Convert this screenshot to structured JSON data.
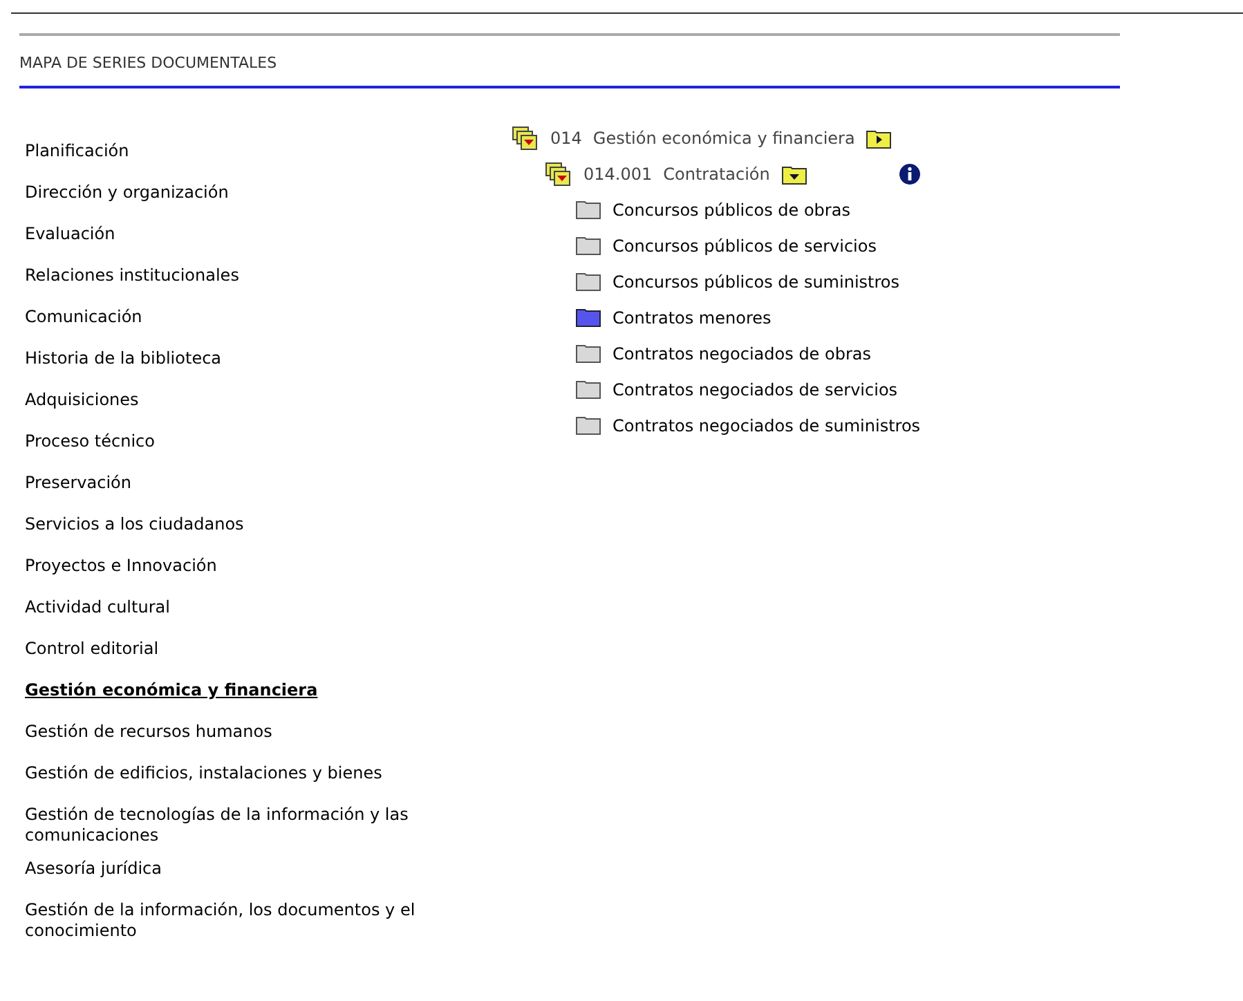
{
  "header": {
    "title": "MAPA DE SERIES DOCUMENTALES"
  },
  "functions": [
    {
      "label": "Planificación",
      "selected": false
    },
    {
      "label": "Dirección y organización",
      "selected": false
    },
    {
      "label": "Evaluación",
      "selected": false
    },
    {
      "label": "Relaciones institucionales",
      "selected": false
    },
    {
      "label": "Comunicación",
      "selected": false
    },
    {
      "label": "Historia de la biblioteca",
      "selected": false
    },
    {
      "label": "Adquisiciones",
      "selected": false
    },
    {
      "label": "Proceso técnico",
      "selected": false
    },
    {
      "label": "Preservación",
      "selected": false
    },
    {
      "label": "Servicios a los ciudadanos",
      "selected": false
    },
    {
      "label": "Proyectos e Innovación",
      "selected": false
    },
    {
      "label": "Actividad cultural",
      "selected": false
    },
    {
      "label": "Control editorial",
      "selected": false
    },
    {
      "label": "Gestión económica y financiera",
      "selected": true
    },
    {
      "label": "Gestión de recursos humanos",
      "selected": false
    },
    {
      "label": "Gestión de edificios, instalaciones y bienes",
      "selected": false
    },
    {
      "label": "Gestión de tecnologías de la información y las comunicaciones",
      "selected": false
    },
    {
      "label": "Asesoría jurídica",
      "selected": false
    },
    {
      "label": "Gestión de la información, los documentos y el conocimiento",
      "selected": false
    }
  ],
  "tree": {
    "code": "014",
    "name": "Gestión económica y financiera",
    "expanded": true,
    "children": [
      {
        "code": "014.001",
        "name": "Contratación",
        "expanded": true,
        "children": [
          {
            "label": "Concursos públicos de obras",
            "selected": false
          },
          {
            "label": "Concursos públicos de servicios",
            "selected": false
          },
          {
            "label": "Concursos públicos de suministros",
            "selected": false
          },
          {
            "label": "Contratos menores",
            "selected": true
          },
          {
            "label": "Contratos negociados de obras",
            "selected": false
          },
          {
            "label": "Contratos negociados de servicios",
            "selected": false
          },
          {
            "label": "Contratos negociados de suministros",
            "selected": false
          }
        ]
      }
    ]
  }
}
